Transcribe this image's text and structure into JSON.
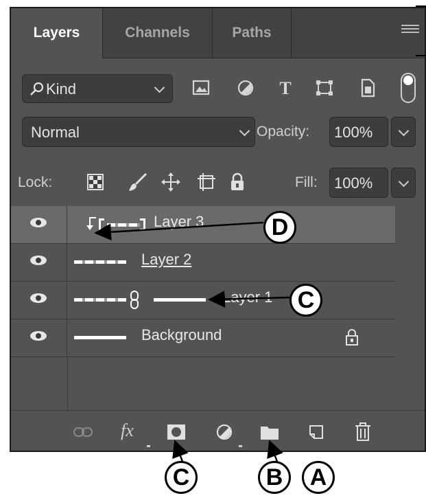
{
  "tabs": [
    {
      "label": "Layers"
    },
    {
      "label": "Channels"
    },
    {
      "label": "Paths"
    }
  ],
  "filter": {
    "label": "Kind"
  },
  "blend": {
    "mode": "Normal",
    "opacity_label": "Opacity:",
    "opacity_value": "100%"
  },
  "lock": {
    "label": "Lock:",
    "fill_label": "Fill:",
    "fill_value": "100%"
  },
  "layers": [
    {
      "name": "Layer 3"
    },
    {
      "name": "Layer 2"
    },
    {
      "name": "Layer 1"
    },
    {
      "name": "Background"
    }
  ],
  "toolbar": {
    "fx_label": "fx"
  },
  "callouts": {
    "d": "D",
    "c_layer": "C",
    "c_bottom": "C",
    "b": "B",
    "a": "A"
  }
}
